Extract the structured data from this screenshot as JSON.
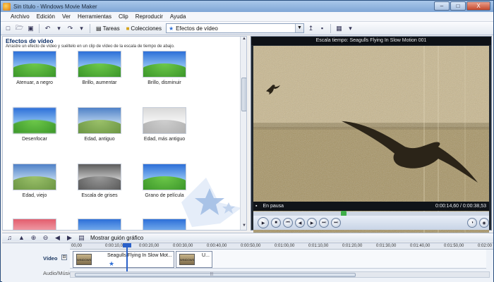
{
  "window": {
    "title": "Sin título - Windows Movie Maker",
    "min_label": "–",
    "max_label": "□",
    "close_label": "X"
  },
  "menu": [
    "Archivo",
    "Edición",
    "Ver",
    "Herramientas",
    "Clip",
    "Reproducir",
    "Ayuda"
  ],
  "toolbar": {
    "tasks_label": "Tareas",
    "collections_label": "Colecciones",
    "collection_selected": "Efectos de vídeo"
  },
  "effects_panel": {
    "title": "Efectos de vídeo",
    "subtitle": "Arrastre un efecto de vídeo y suéltelo en un clip de vídeo de la escala de tiempo de abajo.",
    "items": [
      {
        "label": "Atenuar, a negro",
        "style": "normal"
      },
      {
        "label": "Brillo, aumentar",
        "style": "normal"
      },
      {
        "label": "Brillo, disminuir",
        "style": "normal"
      },
      {
        "label": "Desenfocar",
        "style": "soft"
      },
      {
        "label": "Edad, antiguo",
        "style": "old"
      },
      {
        "label": "Edad, más antiguo",
        "style": "pale"
      },
      {
        "label": "Edad, viejo",
        "style": "old"
      },
      {
        "label": "Escala de grises",
        "style": "gray"
      },
      {
        "label": "Grano de película",
        "style": "normal"
      },
      {
        "label": "",
        "style": "red"
      },
      {
        "label": "",
        "style": "normal"
      },
      {
        "label": "",
        "style": "normal"
      }
    ]
  },
  "preview": {
    "title": "Escala tiempo: Seagulls Flying In Slow Motion 001",
    "status": "En pausa",
    "time": "0:00:14,60 / 0:00:38,53",
    "seek_fraction": 0.38
  },
  "storyboard": {
    "show_label": "Mostrar guión gráfico"
  },
  "timeline": {
    "ruler": [
      "00,00",
      "0:00:10,00",
      "0:00:20,00",
      "0:00:30,00",
      "0:00:40,00",
      "0:00:50,00",
      "0:01:00,00",
      "0:01:10,00",
      "0:01:20,00",
      "0:01:30,00",
      "0:01:40,00",
      "0:01:50,00",
      "0:02:00"
    ],
    "tracks": {
      "video": "Vídeo",
      "audio": "Audio/Música"
    },
    "clips": [
      {
        "title": "Seagulls Flying In Slow Mot...",
        "thumb": "WINDOWS"
      },
      {
        "title": "U...",
        "thumb": "WINDOWS"
      }
    ]
  },
  "colors": {
    "accent": "#2a61c9",
    "title_text": "#0d2f66"
  }
}
